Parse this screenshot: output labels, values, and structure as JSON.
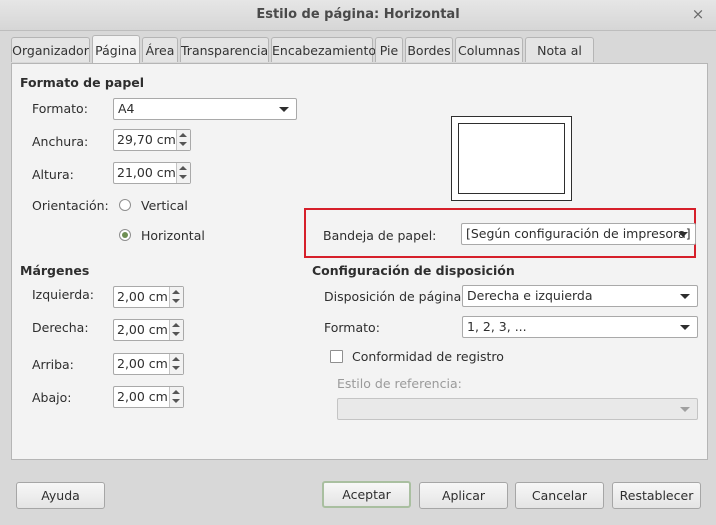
{
  "window": {
    "title": "Estilo de página: Horizontal",
    "close_glyph": "×"
  },
  "tabs": [
    {
      "label": "Organizador"
    },
    {
      "label": "Página"
    },
    {
      "label": "Área"
    },
    {
      "label": "Transparencia"
    },
    {
      "label": "Encabezamiento"
    },
    {
      "label": "Pie"
    },
    {
      "label": "Bordes"
    },
    {
      "label": "Columnas"
    },
    {
      "label": "Nota al pie"
    }
  ],
  "paper_format": {
    "section_title": "Formato de papel",
    "format_label": "Formato:",
    "format_value": "A4",
    "width_label": "Anchura:",
    "width_value": "29,70 cm",
    "height_label": "Altura:",
    "height_value": "21,00 cm",
    "orientation_label": "Orientación:",
    "orientation_options": [
      {
        "label": "Vertical",
        "selected": false
      },
      {
        "label": "Horizontal",
        "selected": true
      }
    ]
  },
  "paper_tray": {
    "label": "Bandeja de papel:",
    "value": "[Según configuración de impresora]"
  },
  "margins": {
    "section_title": "Márgenes",
    "left_label": "Izquierda:",
    "left_value": "2,00 cm",
    "right_label": "Derecha:",
    "right_value": "2,00 cm",
    "top_label": "Arriba:",
    "top_value": "2,00 cm",
    "bottom_label": "Abajo:",
    "bottom_value": "2,00 cm"
  },
  "layout": {
    "section_title": "Configuración de disposición",
    "page_layout_label": "Disposición de página:",
    "page_layout_value": "Derecha e izquierda",
    "format_label": "Formato:",
    "format_value": "1, 2, 3, ...",
    "register_label": "Conformidad de registro",
    "register_checked": false,
    "reference_style_label": "Estilo de referencia:",
    "reference_style_value": ""
  },
  "buttons": {
    "help": "Ayuda",
    "ok": "Aceptar",
    "apply": "Aplicar",
    "cancel": "Cancelar",
    "reset": "Restablecer"
  },
  "colors": {
    "highlight": "#d61f2a",
    "radio_selected": "#6f8f54"
  }
}
